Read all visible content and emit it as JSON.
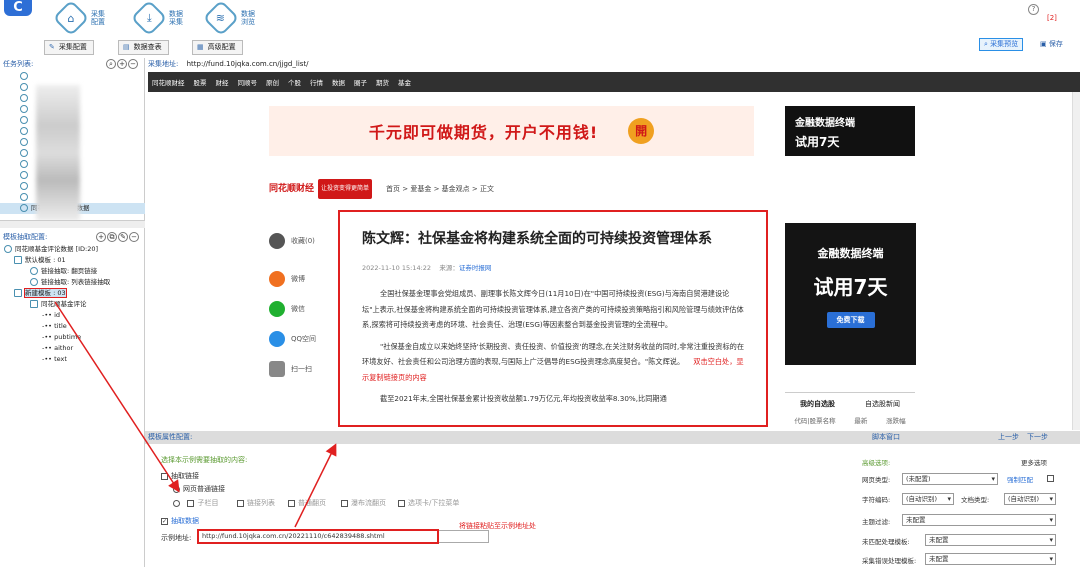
{
  "app": {
    "nav": [
      {
        "icon": "home-icon",
        "glyph": "⌂",
        "label": "采集配置"
      },
      {
        "icon": "download-icon",
        "glyph": "⤓",
        "label": "数据采集"
      },
      {
        "icon": "database-icon",
        "glyph": "≋",
        "label": "数据浏览"
      }
    ],
    "subnav": [
      "采集配置",
      "数据查表",
      "高级配置"
    ],
    "help_label": "[2]",
    "preview_label": "采集预览",
    "save_label": "保存"
  },
  "left": {
    "tasks_title": "任务列表:",
    "task_selected": "同花顺基金评论数据",
    "template_title": "模板抽取配置:",
    "tree": [
      {
        "label": "同花顺基金评论数据 [ID:20]",
        "level": 0
      },
      {
        "label": "默认模板 : 01",
        "level": 1
      },
      {
        "label": "链接抽取: 翻页链接",
        "level": 2
      },
      {
        "label": "链接抽取: 列表链接抽取",
        "level": 2
      },
      {
        "label": "新建模板 : 03",
        "level": 1
      },
      {
        "label": "同花顺基金评论",
        "level": 2
      },
      {
        "label": "id",
        "level": 3
      },
      {
        "label": "title",
        "level": 3
      },
      {
        "label": "pubtime",
        "level": 3
      },
      {
        "label": "aithor",
        "level": 3
      },
      {
        "label": "text",
        "level": 3
      }
    ]
  },
  "urlbar": {
    "label": "采集地址:",
    "url": "http://fund.10jqka.com.cn/jjgd_list/"
  },
  "page": {
    "sitenav": [
      "同花顺财经",
      "股票",
      "财经",
      "同顺号",
      "原创",
      "个股",
      "行情",
      "数据",
      "圈子",
      "期货",
      "基金"
    ],
    "banner_text": "千元即可做期货，开户不用钱!",
    "banner_button": "開",
    "ad_small_l1": "金融数据终端",
    "ad_small_l2": "试用7天",
    "crumb_logo": "同花顺财经",
    "crumb_ad": "让投资变得更简单",
    "crumbs": "首页 > 爱基金 > 基金观点 > 正文",
    "shares": [
      {
        "icon": "star-icon",
        "label": "收藏(0)",
        "color": "#555555"
      },
      {
        "icon": "weibo-icon",
        "label": "微博",
        "color": "#f07020"
      },
      {
        "icon": "wechat-icon",
        "label": "微信",
        "color": "#20b030"
      },
      {
        "icon": "qq-icon",
        "label": "QQ空间",
        "color": "#2a8fe6"
      },
      {
        "icon": "scan-icon",
        "label": "扫一扫",
        "color": "#888888"
      }
    ],
    "title": "陈文辉：社保基金将构建系统全面的可持续投资管理体系",
    "date": "2022-11-10 15:14:22",
    "source_label": "来源：",
    "source": "证券时报网",
    "p1": "全国社保基金理事会党组成员、副理事长陈文辉今日(11月10日)在\"中国可持续投资(ESG)与海南自贸港建设论坛\"上表示,社保基金将构建系统全面的可持续投资管理体系,建立各资产类的可持续投资策略指引和风险管理与绩效评估体系,探索将可持续投资考虑的环境、社会责任、治理(ESG)等因素整合到基金投资管理的全流程中。",
    "p2": "\"社保基金自成立以来始终坚持'长期投资、责任投资、价值投资'的理念,在关注财务收益的同时,非常注重投资标的在环境友好、社会责任和公司治理方面的表现,与国际上广泛倡导的ESG投资理念高度契合。\"陈文辉说。",
    "hint": "双击空白处，显示复制链接页的内容",
    "p3": "截至2021年末,全国社保基金累计投资收益额1.79万亿元,年均投资收益率8.30%,比同期通",
    "ad_big_l1": "金融数据终端",
    "ad_big_l2": "试用7天",
    "ad_big_btn": "免费下载",
    "tabs": [
      "我的自选股",
      "自选股新闻"
    ],
    "tab_cols": [
      "代码|股票名称",
      "最新",
      "涨跌幅"
    ]
  },
  "cfg": {
    "title": "模板属性配置:",
    "link_label": "脚本窗口",
    "prev": "上一步",
    "next": "下一步",
    "extract_hint": "选择本示例需要抽取的内容:",
    "extract_link": "抽取链接",
    "opt_normal": "网页普通链接",
    "opt_sub": "子栏目",
    "opt_list": "链接列表",
    "opt_page": "普通翻页",
    "opt_scroll": "瀑布流翻页",
    "opt_tab": "选项卡/下拉菜单",
    "extract_data": "抽取数据",
    "example_label": "示例地址:",
    "example_url": "http://fund.10jqka.com.cn/20221110/c642839488.shtml",
    "paste_hint": "将链接粘贴至示例地址处",
    "adv_title": "高级选项:",
    "more": "更多选项",
    "page_type_label": "网页类型:",
    "page_type": "(未配置)",
    "force_match": "强制匹配",
    "charset_label": "字符编码:",
    "charset": "(自动识别)",
    "doctype_label": "文档类型:",
    "doctype": "(自动识别)",
    "topic_label": "主题过滤:",
    "topic": "未配置",
    "nomatch_label": "未匹配处理模板:",
    "nomatch": "未配置",
    "err_label": "采集错误处理模板:",
    "err": "未配置"
  }
}
